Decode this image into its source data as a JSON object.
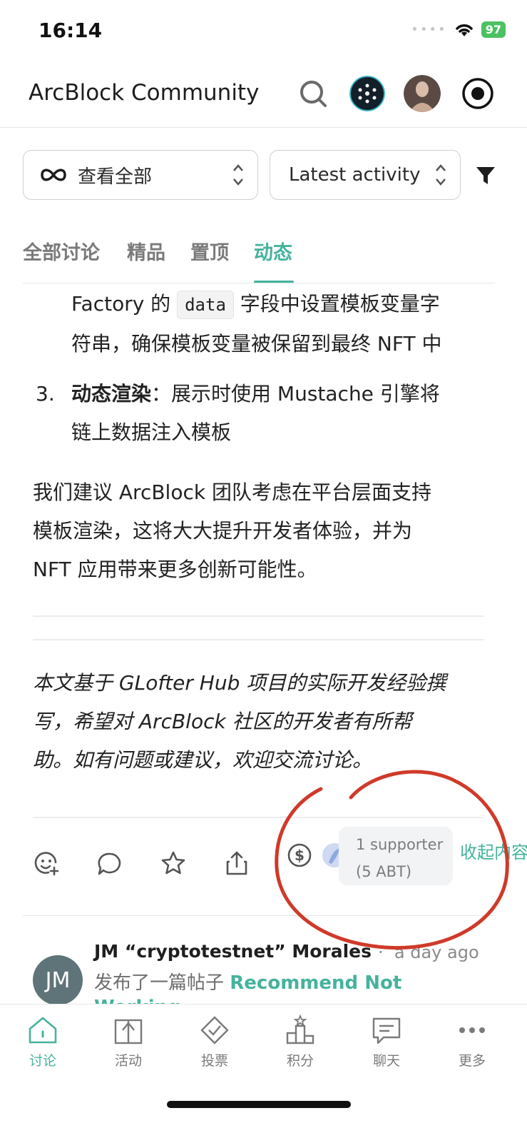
{
  "status_bar": {
    "time": "16:14",
    "battery": "97"
  },
  "header": {
    "title": "ArcBlock Community"
  },
  "filters": {
    "scope_select": "查看全部",
    "sort_select": "Latest activity"
  },
  "tabs": [
    {
      "label": "全部讨论"
    },
    {
      "label": "精品"
    },
    {
      "label": "置顶"
    },
    {
      "label": "动态"
    }
  ],
  "article": {
    "list_item_2": {
      "before_code": "Factory 的",
      "code": "data",
      "after_code": "字段中设置模板变量字",
      "line2": "符串，确保模板变量被保留到最终 NFT 中"
    },
    "list_item_3": {
      "number": "3.",
      "bold": "动态渲染",
      "rest": "：展示时使用 Mustache 引擎将",
      "line2": "链上数据注入模板"
    },
    "paragraph": [
      "我们建议 ArcBlock 团队考虑在平台层面支持",
      "模板渲染，这将大大提升开发者体验，并为",
      "NFT 应用带来更多创新可能性。"
    ],
    "italic_note": [
      "本文基于 GLofter Hub 项目的实际开发经验撰",
      "写，希望对 ArcBlock 社区的开发者有所帮",
      "助。如有问题或建议，欢迎交流讨论。"
    ]
  },
  "actions": {
    "supporters": "1 supporter",
    "amount": "(5 ABT)",
    "collapse": "收起内容"
  },
  "activity": {
    "avatar_initials": "JM",
    "user": "JM “cryptotestnet” Morales",
    "separator": "·",
    "time": "a day ago",
    "action": "发布了一篇帖子",
    "post_title": "Recommend Not",
    "post_title_cont": "Working"
  },
  "bottom_nav": [
    {
      "label": "讨论",
      "icon": "home-icon"
    },
    {
      "label": "活动",
      "icon": "gift-icon"
    },
    {
      "label": "投票",
      "icon": "vote-icon"
    },
    {
      "label": "积分",
      "icon": "leaderboard-icon"
    },
    {
      "label": "聊天",
      "icon": "chat-icon"
    },
    {
      "label": "更多",
      "icon": "more-icon"
    }
  ],
  "colors": {
    "accent": "#45b39d",
    "annotation": "#d0392b"
  }
}
